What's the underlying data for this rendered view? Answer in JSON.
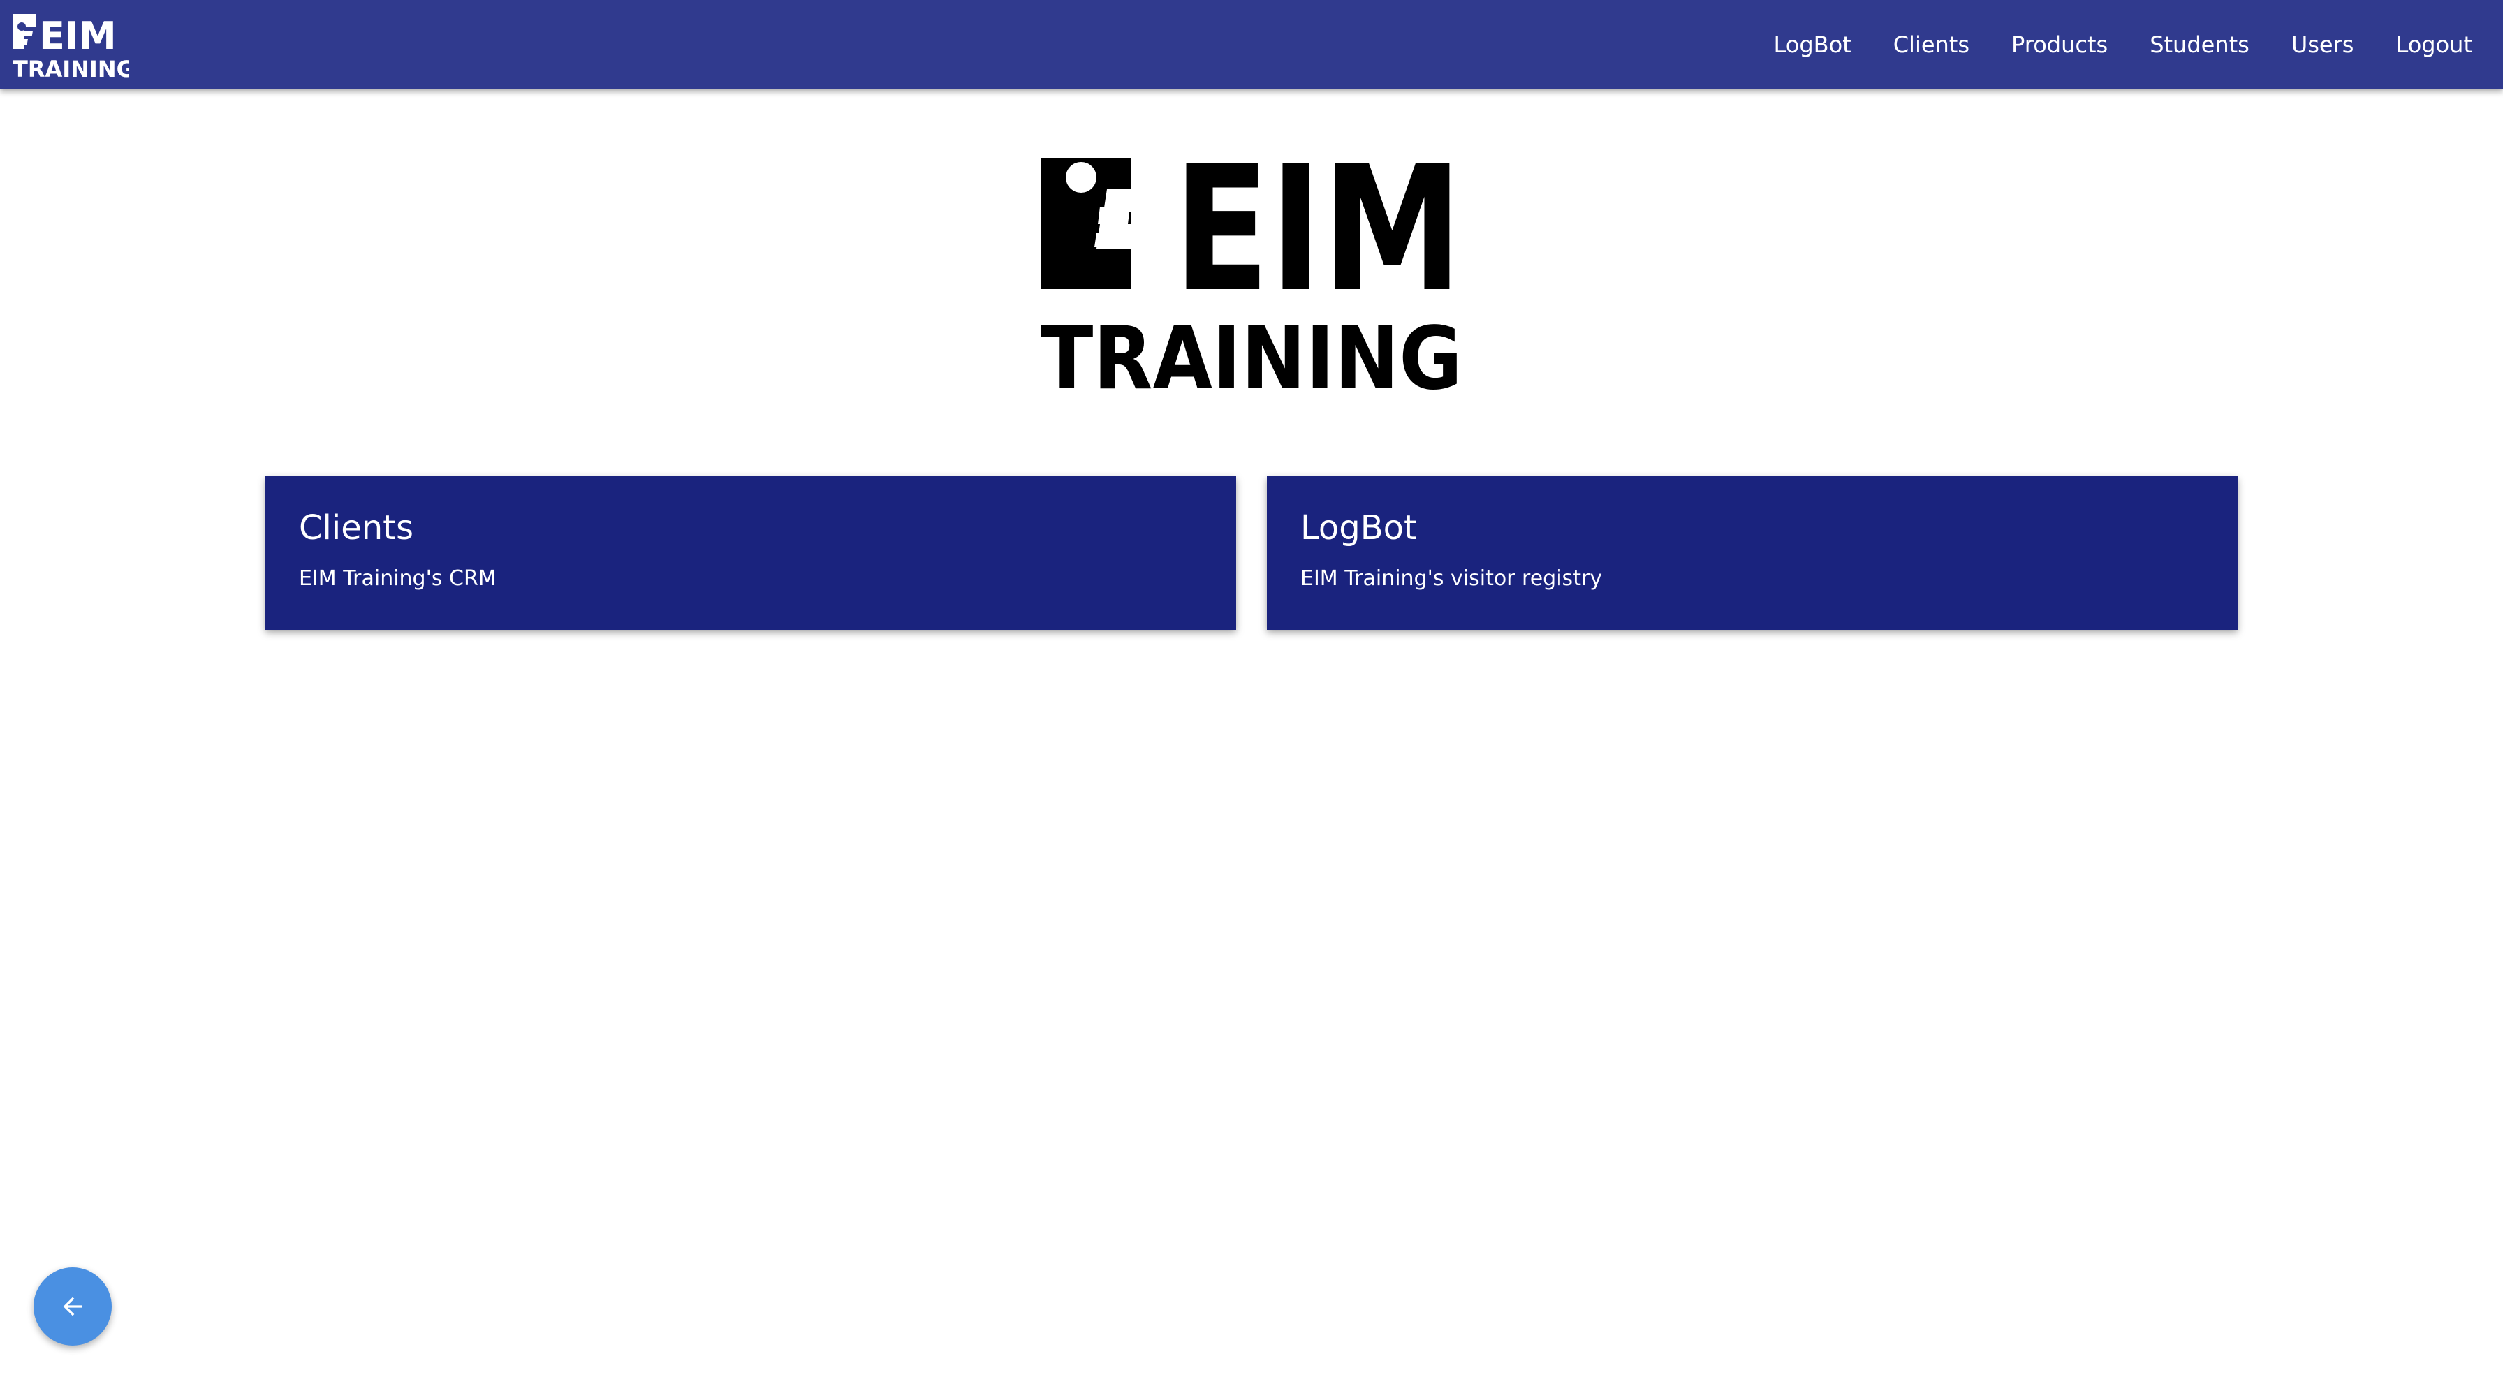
{
  "brand": {
    "logo_line1": "EIM",
    "logo_line2": "TRAINING",
    "nav_color": "#303a8e",
    "card_color": "#1a237e",
    "fab_color": "#4a90e2"
  },
  "nav": {
    "items": [
      {
        "label": "LogBot"
      },
      {
        "label": "Clients"
      },
      {
        "label": "Products"
      },
      {
        "label": "Students"
      },
      {
        "label": "Users"
      },
      {
        "label": "Logout"
      }
    ]
  },
  "cards": [
    {
      "title": "Clients",
      "subtitle": "EIM Training's CRM"
    },
    {
      "title": "LogBot",
      "subtitle": "EIM Training's visitor registry"
    }
  ],
  "fab": {
    "icon": "arrow-left-icon"
  }
}
